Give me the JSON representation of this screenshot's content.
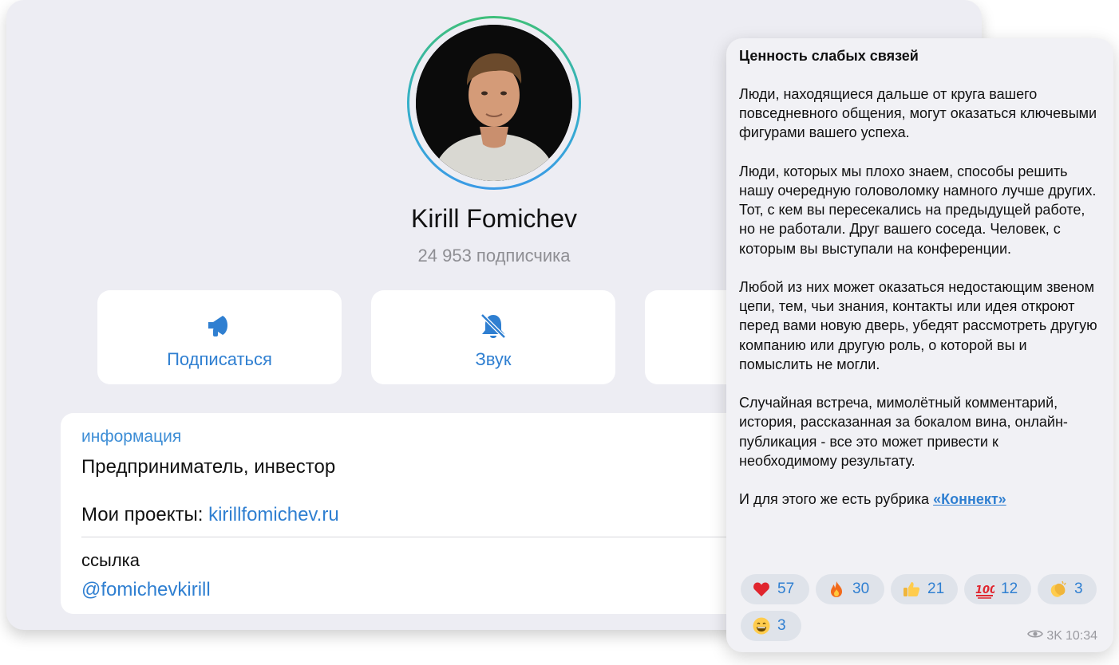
{
  "profile": {
    "name": "Kirill Fomichev",
    "subscribers": "24 953 подписчика",
    "actions": [
      {
        "label": "Подписаться",
        "icon": "megaphone-icon"
      },
      {
        "label": "Звук",
        "icon": "bell-muted-icon"
      },
      {
        "label": "",
        "icon": ""
      }
    ],
    "info": {
      "label": "информация",
      "text": "Предприниматель, инвестор",
      "projects_prefix": "Мои проекты:",
      "projects_link": "kirillfomichev.ru"
    },
    "link": {
      "label": "ссылка",
      "handle": "@fomichevkirill"
    }
  },
  "message": {
    "title": "Ценность слабых связей",
    "paragraphs": [
      "Люди, находящиеся дальше от круга вашего повседневного общения, могут оказаться ключевыми фигурами вашего успеха.",
      "Люди, которых мы плохо знаем, способы решить нашу очередную головоломку намного лучше других. Тот, с кем вы пересекались на предыдущей работе, но не работали. Друг вашего соседа. Человек, с которым вы выступали на конференции.",
      "Любой из них может оказаться недостающим звеном цепи, тем, чьи знания, контакты или идея откроют перед вами новую дверь, убедят рассмотреть другую компанию или другую роль, о которой вы и помыслить не могли.",
      "Случайная встреча, мимолётный комментарий, история, рассказанная за бокалом вина, онлайн-публикация - все это может привести к необходимому результату."
    ],
    "last_line_prefix": "И для этого же есть рубрика",
    "last_line_link": "«Коннект»",
    "reactions": [
      {
        "emoji": "heart-icon",
        "count": "57"
      },
      {
        "emoji": "fire-icon",
        "count": "30"
      },
      {
        "emoji": "thumbs-up-icon",
        "count": "21"
      },
      {
        "emoji": "hundred-points-icon",
        "count": "12"
      },
      {
        "emoji": "clapping-hands-icon",
        "count": "3"
      },
      {
        "emoji": "grinning-face-icon",
        "count": "3"
      }
    ],
    "views": "3K",
    "time": "10:34"
  },
  "colors": {
    "accent": "#2f7fd1",
    "card_bg": "#ededf3",
    "reaction_bg": "#dfe3ea"
  }
}
